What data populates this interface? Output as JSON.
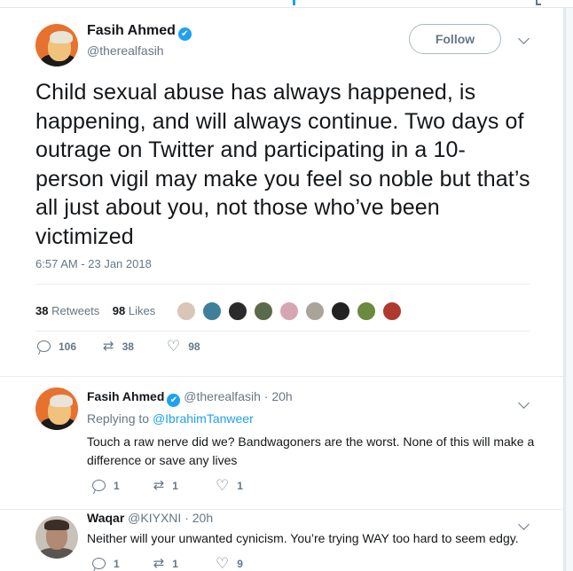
{
  "main_tweet": {
    "author_name": "Fasih Ahmed",
    "author_handle": "@therealfasih",
    "verified_icon": "✔",
    "follow_label": "Follow",
    "text": "Child sexual abuse has always happened, is happening, and will always continue. Two days of outrage on Twitter and participating in a 10-person vigil may make you feel so noble but that’s all just about you, not those who’ve been victimized",
    "timestamp": "6:57 AM - 23 Jan 2018",
    "retweets_count": "38",
    "retweets_label": "Retweets",
    "likes_count": "98",
    "likes_label": "Likes",
    "reply_count": "106",
    "retweet_count": "38",
    "like_count": "98",
    "liker_colors": [
      "#d9c6b8",
      "#3f7f9a",
      "#2b2b2b",
      "#5a6a4a",
      "#d7a6b4",
      "#a9a39a",
      "#222222",
      "#6b8a3f",
      "#b0392f"
    ]
  },
  "replies": [
    {
      "author_name": "Fasih Ahmed",
      "author_handle": "@therealfasih",
      "time": "20h",
      "replying_label": "Replying to",
      "replying_to": "@IbrahimTanweer",
      "text": "Touch a raw nerve did we? Bandwagoners are the worst. None of this will make a difference or save any lives",
      "reply_count": "1",
      "retweet_count": "1",
      "like_count": "1"
    },
    {
      "author_name": "Waqar",
      "author_handle": "@KIYXNI",
      "time": "20h",
      "text": "Neither will your unwanted cynicism. You’re trying WAY too hard to seem edgy.",
      "reply_count": "1",
      "retweet_count": "1",
      "like_count": "9"
    }
  ],
  "sep": "·",
  "icons": {
    "reply": "reply-icon",
    "retweet": "retweet-icon",
    "like": "heart-icon",
    "more": "chevron-down-icon",
    "retweet_glyph": "⇄",
    "like_glyph": "♡"
  },
  "colors": {
    "accent": "#1da1f2",
    "muted": "#657786",
    "text": "#14171a"
  }
}
